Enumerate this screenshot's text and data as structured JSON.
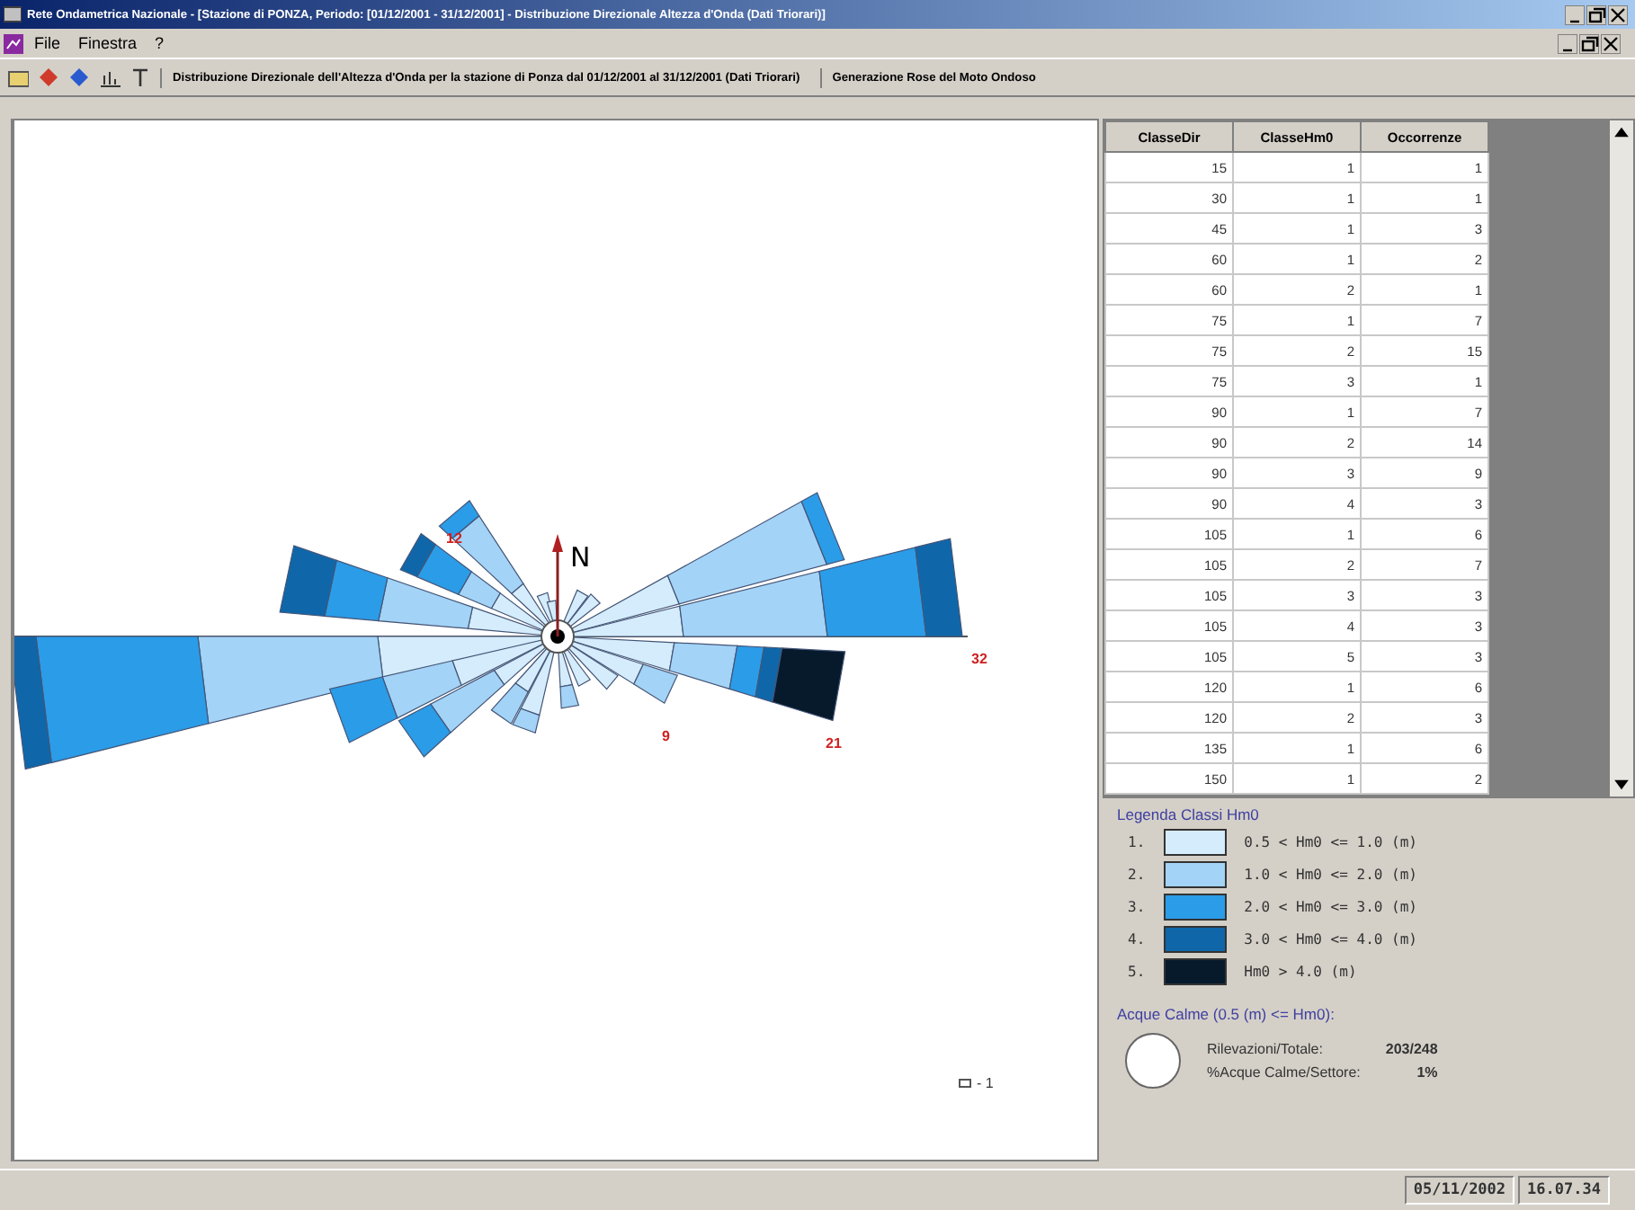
{
  "window": {
    "title": "Rete Ondametrica Nazionale - [Stazione di PONZA, Periodo: [01/12/2001 - 31/12/2001] - Distribuzione Direzionale Altezza d'Onda (Dati Triorari)]"
  },
  "menu": [
    "File",
    "Finestra",
    "?"
  ],
  "toolbar": {
    "buttons": [
      "Distribuzione Direzionale dell'Altezza d'Onda per la stazione di Ponza dal 01/12/2001 al 31/12/2001 (Dati Triorari)",
      "Generazione Rose del Moto Ondoso"
    ]
  },
  "rose": {
    "north": "N",
    "labels": [
      "12",
      "32",
      "9",
      "21"
    ],
    "scale": "- 1"
  },
  "table": {
    "columns": [
      "ClasseDir",
      "ClasseHm0",
      "Occorrenze"
    ],
    "rows": [
      [
        "15",
        "1",
        "1"
      ],
      [
        "30",
        "1",
        "1"
      ],
      [
        "45",
        "1",
        "3"
      ],
      [
        "60",
        "1",
        "2"
      ],
      [
        "60",
        "2",
        "1"
      ],
      [
        "75",
        "1",
        "7"
      ],
      [
        "75",
        "2",
        "15"
      ],
      [
        "75",
        "3",
        "1"
      ],
      [
        "90",
        "1",
        "7"
      ],
      [
        "90",
        "2",
        "14"
      ],
      [
        "90",
        "3",
        "9"
      ],
      [
        "90",
        "4",
        "3"
      ],
      [
        "105",
        "1",
        "6"
      ],
      [
        "105",
        "2",
        "7"
      ],
      [
        "105",
        "3",
        "3"
      ],
      [
        "105",
        "4",
        "3"
      ],
      [
        "105",
        "5",
        "3"
      ],
      [
        "120",
        "1",
        "6"
      ],
      [
        "120",
        "2",
        "3"
      ],
      [
        "135",
        "1",
        "6"
      ],
      [
        "150",
        "1",
        "2"
      ]
    ]
  },
  "legend": {
    "title": "Legenda Classi Hm0",
    "items": [
      {
        "number": "1.",
        "label": "0.5 < Hm0 <= 1.0 (m)",
        "color": "#d4ecfb"
      },
      {
        "number": "2.",
        "label": "1.0 < Hm0 <= 2.0 (m)",
        "color": "#a3d3f6"
      },
      {
        "number": "3.",
        "label": "2.0 < Hm0 <= 3.0 (m)",
        "color": "#2b9ce8"
      },
      {
        "number": "4.",
        "label": "3.0 < Hm0 <= 4.0 (m)",
        "color": "#0f67aa"
      },
      {
        "number": "5.",
        "label": "Hm0 > 4.0 (m)",
        "color": "#071a2c"
      }
    ]
  },
  "calm": {
    "title": "Acque Calme (0.5 (m) <= Hm0):",
    "stats": [
      {
        "label": "Rilevazioni/Totale:",
        "value": "203/248"
      },
      {
        "label": "%Acque Calme/Settore:",
        "value": "1%"
      }
    ]
  },
  "status": {
    "date": "05/11/2002",
    "time": "16.07.34"
  }
}
